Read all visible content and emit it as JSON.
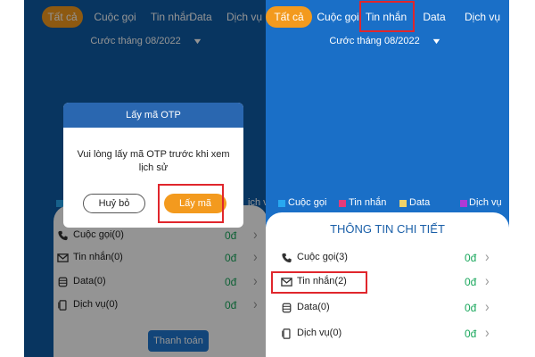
{
  "colors": {
    "accent": "#f39a1e",
    "highlight_box": "#e0262c",
    "value_green": "#19a75c",
    "legend_cuoc_goi": "#28a8f0",
    "legend_tin_nhan": "#e63a7a",
    "legend_data": "#f0d36a",
    "legend_dich_vu": "#b03ad6"
  },
  "left": {
    "tabs": [
      "Tất cả",
      "Cuộc gọi",
      "Tin nhắn",
      "Data",
      "Dịch vụ"
    ],
    "month": "Cước tháng 08/2022",
    "legend_fragment": "ịch vụ",
    "dialog": {
      "title": "Lấy mã OTP",
      "message": "Vui lòng lấy mã OTP trước khi xem lịch sử",
      "cancel": "Huỷ bỏ",
      "confirm": "Lấy mã"
    },
    "rows": [
      {
        "icon": "phone-icon",
        "label": "Cuộc gọi(0)",
        "value": "0đ"
      },
      {
        "icon": "mail-icon",
        "label": "Tin nhắn(0)",
        "value": "0đ"
      },
      {
        "icon": "database-icon",
        "label": "Data(0)",
        "value": "0đ"
      },
      {
        "icon": "device-icon",
        "label": "Dịch vụ(0)",
        "value": "0đ"
      }
    ],
    "pay_button": "Thanh toán"
  },
  "right": {
    "tabs": [
      "Tất cả",
      "Cuộc gọi",
      "Tin nhắn",
      "Data",
      "Dịch vụ"
    ],
    "month": "Cước tháng 08/2022",
    "legend": [
      "Cuộc gọi",
      "Tin nhắn",
      "Data",
      "Dịch vụ"
    ],
    "sheet_title": "THÔNG TIN CHI TIẾT",
    "rows": [
      {
        "icon": "phone-icon",
        "label": "Cuộc gọi(3)",
        "value": "0đ"
      },
      {
        "icon": "mail-icon",
        "label": "Tin nhắn(2)",
        "value": "0đ"
      },
      {
        "icon": "database-icon",
        "label": "Data(0)",
        "value": "0đ"
      },
      {
        "icon": "device-icon",
        "label": "Dịch vụ(0)",
        "value": "0đ"
      }
    ]
  }
}
